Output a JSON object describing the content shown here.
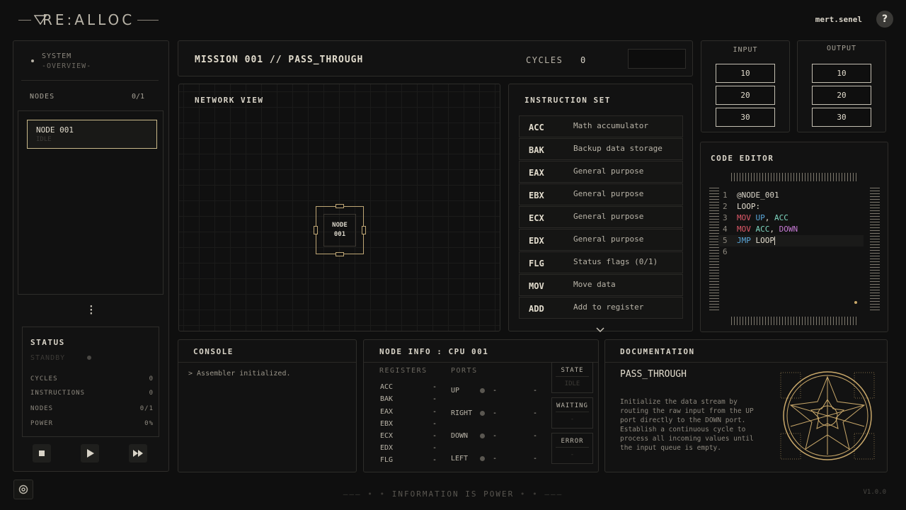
{
  "app": {
    "logo": "RE:ALLOC",
    "user": "mert.senel",
    "help": "?"
  },
  "system": {
    "line1": "SYSTEM",
    "line2": "-OVERVIEW-"
  },
  "nodes": {
    "label": "NODES",
    "count": "0/1",
    "items": [
      {
        "name": "NODE 001",
        "state": "IDLE"
      }
    ]
  },
  "status": {
    "title": "STATUS",
    "state": "STANDBY",
    "rows": [
      {
        "label": "CYCLES",
        "value": "0"
      },
      {
        "label": "INSTRUCTIONS",
        "value": "0"
      },
      {
        "label": "NODES",
        "value": "0/1"
      },
      {
        "label": "POWER",
        "value": "0%"
      }
    ]
  },
  "mission": {
    "title": "MISSION 001 // PASS_THROUGH",
    "cycles_label": "CYCLES",
    "cycles_value": "0"
  },
  "input": {
    "label": "INPUT",
    "values": [
      "10",
      "20",
      "30"
    ]
  },
  "output": {
    "label": "OUTPUT",
    "values": [
      "10",
      "20",
      "30"
    ]
  },
  "network": {
    "label": "NETWORK VIEW",
    "node_line1": "NODE",
    "node_line2": "001"
  },
  "instructions": {
    "label": "INSTRUCTION SET",
    "items": [
      {
        "op": "ACC",
        "desc": "Math accumulator"
      },
      {
        "op": "BAK",
        "desc": "Backup data storage"
      },
      {
        "op": "EAX",
        "desc": "General purpose"
      },
      {
        "op": "EBX",
        "desc": "General purpose"
      },
      {
        "op": "ECX",
        "desc": "General purpose"
      },
      {
        "op": "EDX",
        "desc": "General purpose"
      },
      {
        "op": "FLG",
        "desc": "Status flags (0/1)"
      },
      {
        "op": "MOV",
        "desc": "Move data"
      },
      {
        "op": "ADD",
        "desc": "Add to register"
      }
    ]
  },
  "editor": {
    "label": "CODE EDITOR",
    "line_numbers": [
      "1",
      "2",
      "3",
      "4",
      "5",
      "6"
    ],
    "tokens": {
      "l1": "@NODE_001",
      "l2": "LOOP:",
      "l3a": "MOV",
      "l3b": "UP",
      "l3c": ",",
      "l3d": "ACC",
      "l4a": "MOV",
      "l4b": "ACC",
      "l4c": ",",
      "l4d": "DOWN",
      "l5a": "JMP",
      "l5b": "LOOP"
    }
  },
  "console": {
    "label": "CONSOLE",
    "message": "> Assembler initialized."
  },
  "node_info": {
    "label": "NODE INFO : CPU 001",
    "registers_label": "REGISTERS",
    "ports_label": "PORTS",
    "registers": [
      {
        "name": "ACC",
        "value": "-"
      },
      {
        "name": "BAK",
        "value": "-"
      },
      {
        "name": "EAX",
        "value": "-"
      },
      {
        "name": "EBX",
        "value": "-"
      },
      {
        "name": "ECX",
        "value": "-"
      },
      {
        "name": "EDX",
        "value": "-"
      },
      {
        "name": "FLG",
        "value": "-"
      }
    ],
    "ports": [
      {
        "name": "UP",
        "v1": "-",
        "v2": "-"
      },
      {
        "name": "RIGHT",
        "v1": "-",
        "v2": "-"
      },
      {
        "name": "DOWN",
        "v1": "-",
        "v2": "-"
      },
      {
        "name": "LEFT",
        "v1": "-",
        "v2": "-"
      }
    ],
    "state": {
      "label": "STATE",
      "value": "IDLE"
    },
    "waiting": {
      "label": "WAITING",
      "value": "-"
    },
    "error": {
      "label": "ERROR",
      "value": "-"
    }
  },
  "docs": {
    "label": "DOCUMENTATION",
    "title": "PASS_THROUGH",
    "body": "Initialize the data stream by routing the raw input from the UP port directly to the DOWN port. Establish a continuous cycle to process all incoming values until the input queue is empty."
  },
  "footer": {
    "motto": "INFORMATION IS POWER",
    "version": "V1.0.0"
  },
  "colors": {
    "accent": "#c9a86a",
    "background": "#0f0f0f",
    "panel": "#121212"
  }
}
